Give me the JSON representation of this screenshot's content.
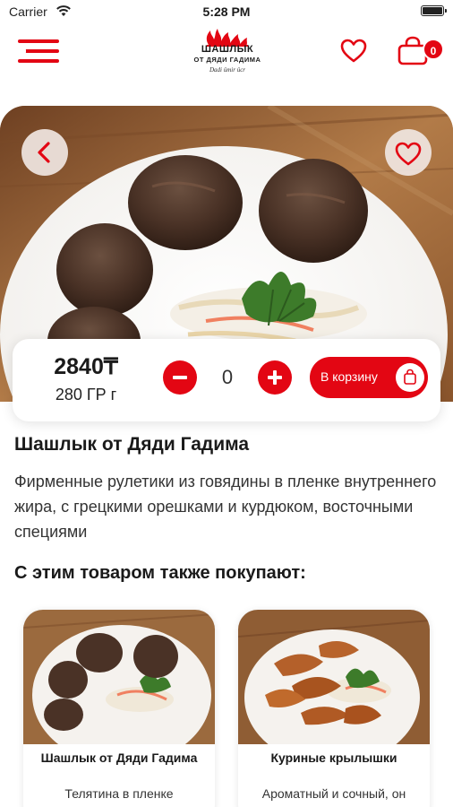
{
  "status_bar": {
    "carrier": "Carrier",
    "time": "5:28 PM"
  },
  "header": {
    "logo_line1": "ШАШЛЫК",
    "logo_line2": "ОТ ДЯДИ ГАДИМА",
    "logo_tagline": "Dadi ümir ücr",
    "cart_count": "0",
    "icons": [
      "menu-icon",
      "heart-icon",
      "shopping-bag-icon"
    ],
    "accent_color": "#e30613"
  },
  "product": {
    "price": "2840₸",
    "weight": "280 ГР г",
    "quantity": "0",
    "add_to_cart_label": "В корзину",
    "title": "Шашлык от Дяди Гадима",
    "description": "Фирменные рулетики из говядины в пленке внутреннего жира, с грецкими орешками и курдюком, восточными специями"
  },
  "related": {
    "title": "С этим товаром также покупают:",
    "items": [
      {
        "name": "Шашлык от Дяди Гадима",
        "description": "Телятина в пленке внутреннего жира, орехи"
      },
      {
        "name": "Куриные крылышки",
        "description": "Ароматный и сочный, он приятно похрустывает"
      }
    ]
  }
}
